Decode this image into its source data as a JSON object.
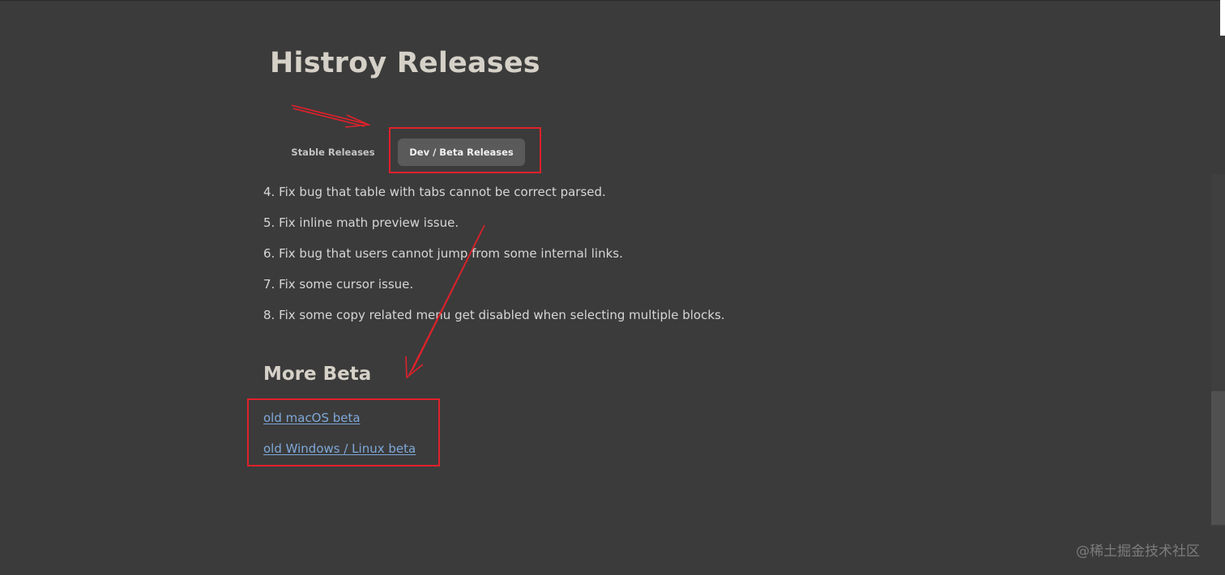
{
  "page": {
    "title": "Histroy Releases"
  },
  "tabs": [
    {
      "label": "Stable Releases",
      "active": false
    },
    {
      "label": "Dev / Beta Releases",
      "active": true
    }
  ],
  "release_notes": [
    "4. Fix bug that table with tabs cannot be correct parsed.",
    "5. Fix inline math preview issue.",
    "6. Fix bug that users cannot jump from some internal links.",
    "7. Fix some cursor issue.",
    "8. Fix some copy related menu get disabled when selecting multiple blocks."
  ],
  "more_beta": {
    "heading": "More Beta",
    "links": [
      {
        "label": "old macOS beta"
      },
      {
        "label": "old Windows / Linux beta"
      }
    ]
  },
  "watermark": "@稀土掘金技术社区",
  "colors": {
    "background": "#3b3b3b",
    "active_tab": "#5a5a5a",
    "link": "#7fa8d8",
    "annotation": "#e0212b"
  },
  "icons": {
    "annotation_arrow": "arrow-icon",
    "highlight_box": "highlight-box"
  }
}
